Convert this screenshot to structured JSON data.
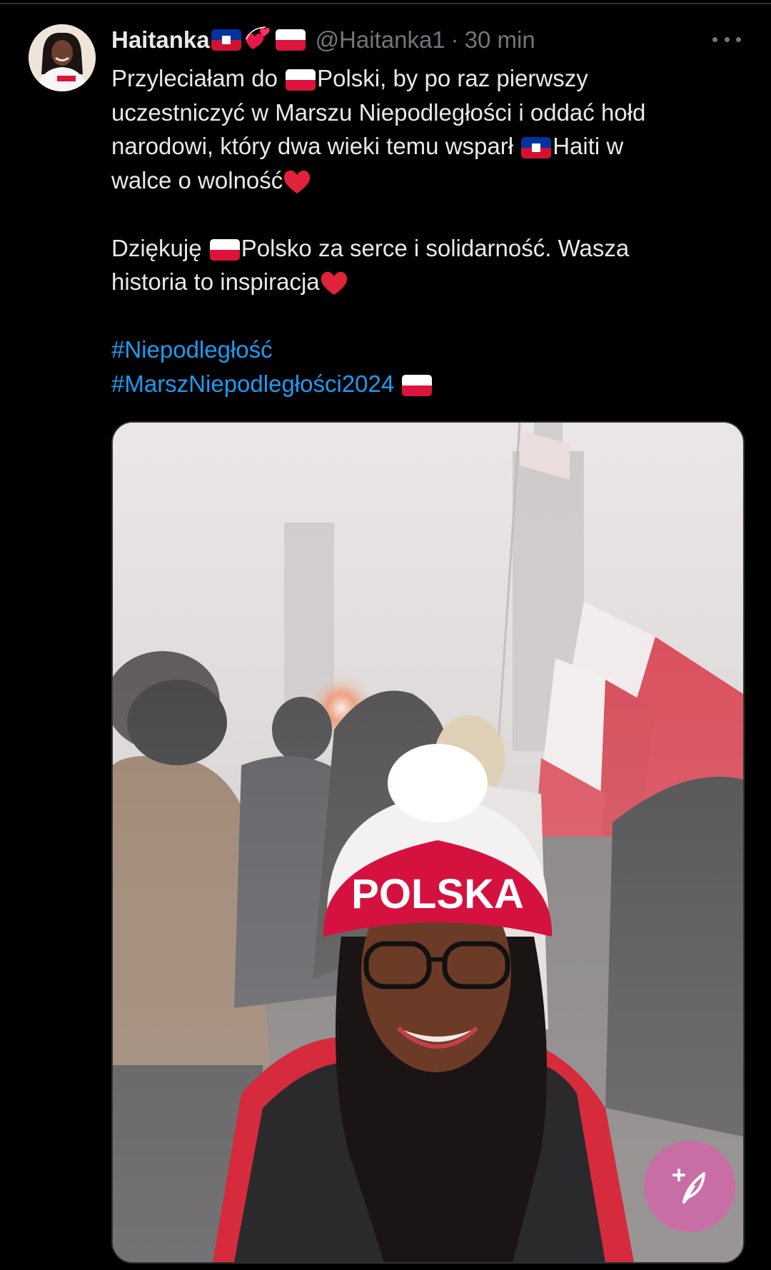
{
  "tweet": {
    "display_name": "Haitanka",
    "handle": "@Haitanka1",
    "separator": "·",
    "time": "30 min",
    "text": {
      "l1a": "Przyleciałam do ",
      "l1b": "Polski, by po raz pierwszy",
      "l2": "uczestniczyć w Marszu Niepodległości i oddać hołd",
      "l3a": "narodowi, który dwa wieki temu wsparł ",
      "l3b": "Haiti w",
      "l4": "walce o wolność",
      "l6a": "Dziękuję ",
      "l6b": "Polsko za serce i solidarność. Wasza",
      "l7": "historia to inspiracja"
    },
    "hashtags": [
      "#Niepodległość",
      "#MarszNiepodległości2024"
    ],
    "media": {
      "hat_text": "POLSKA"
    }
  },
  "icons": {
    "more": "more-horizontal-icon",
    "compose": "compose-post-icon",
    "heart": "red-heart-emoji",
    "flag_pl": "poland-flag-emoji",
    "flag_ht": "haiti-flag-emoji"
  },
  "colors": {
    "background": "#000000",
    "text": "#e7e9ea",
    "secondary": "#71767b",
    "link": "#1d9bf0",
    "fab": "#d664aa"
  }
}
